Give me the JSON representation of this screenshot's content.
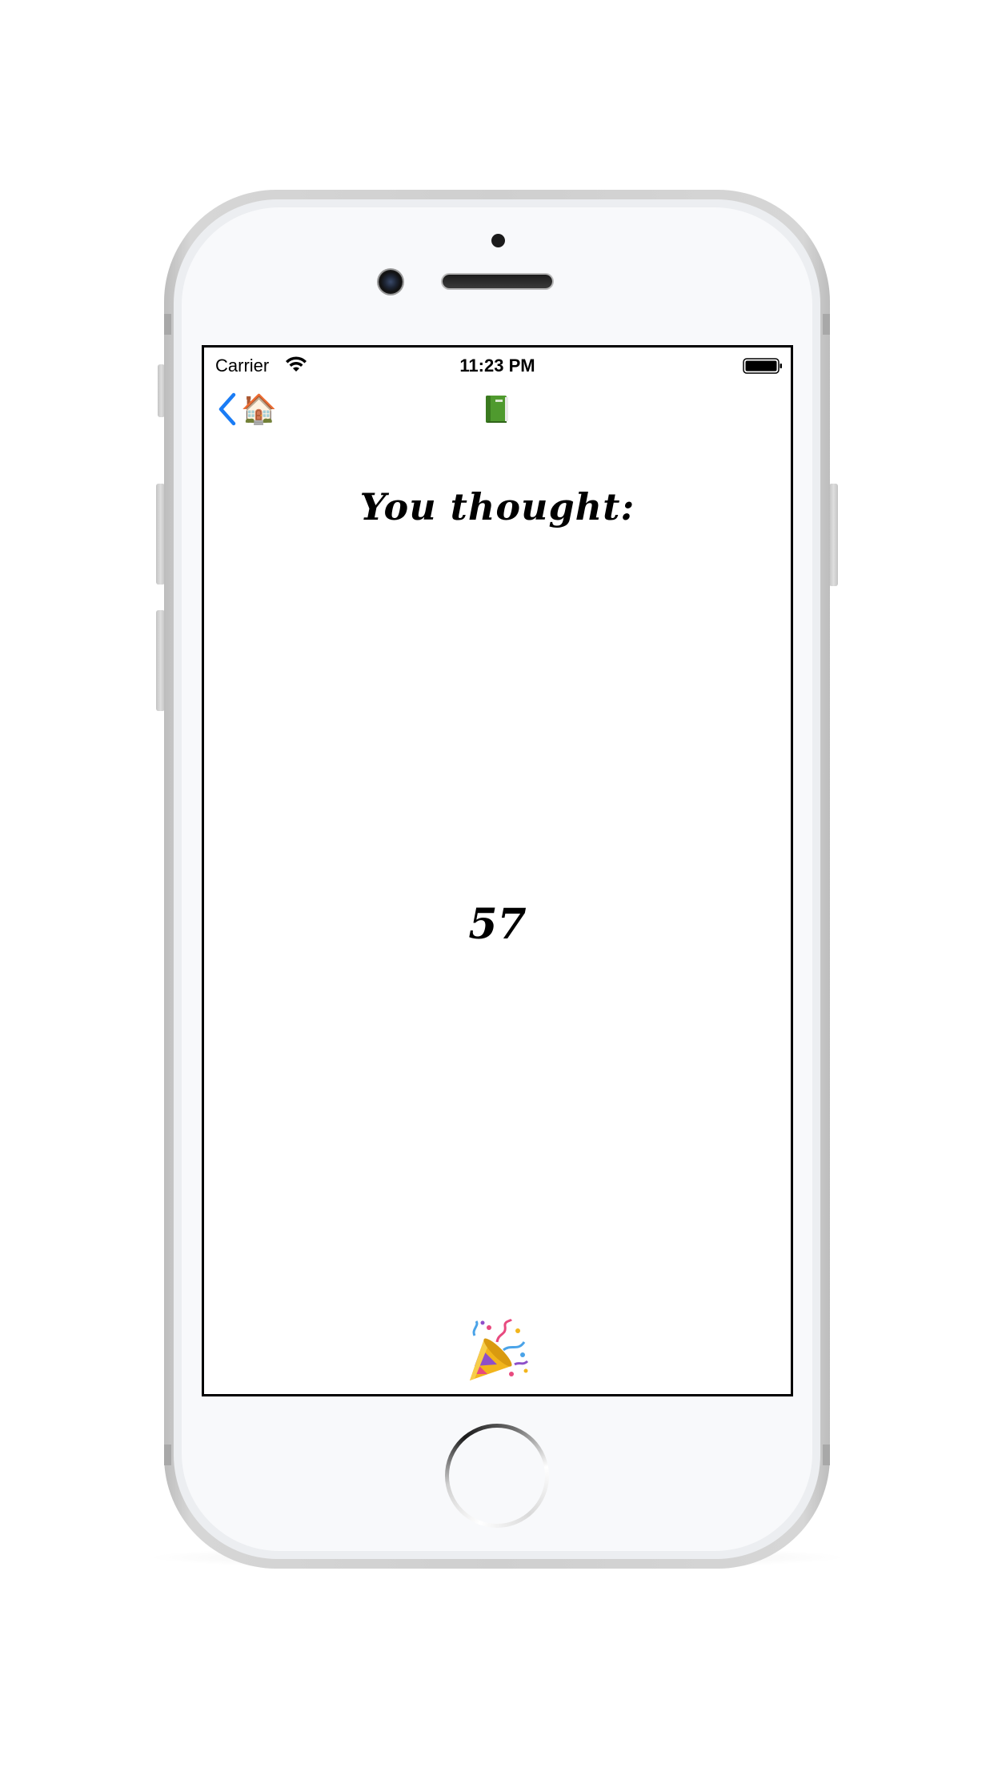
{
  "status_bar": {
    "carrier": "Carrier",
    "time": "11:23 PM",
    "wifi_icon": "wifi-icon",
    "battery_icon": "battery-icon"
  },
  "nav_bar": {
    "back_icon": "chevron-left-icon",
    "home_emoji": "🏠",
    "book_icon": "green-book-icon"
  },
  "main": {
    "title": "You thought:",
    "number": "57"
  },
  "footer": {
    "party_icon": "party-popper-icon"
  },
  "colors": {
    "accent": "#1a7cf5",
    "text": "#000000",
    "screen_border": "#000000",
    "phone_frame": "#cfcfcf"
  }
}
